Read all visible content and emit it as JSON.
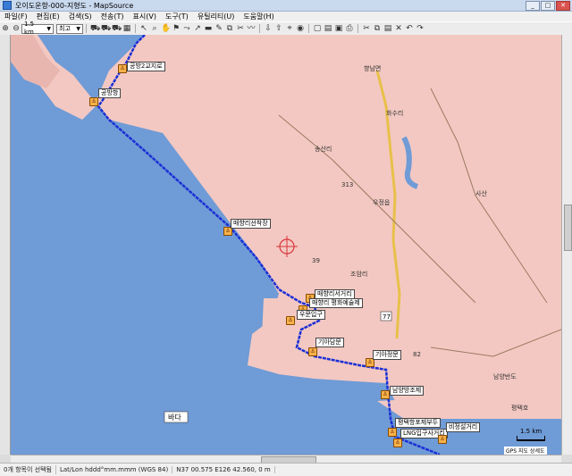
{
  "window": {
    "title": "오이도운항-000-지형도 - MapSource"
  },
  "menu": [
    "파일(F)",
    "편집(E)",
    "검색(S)",
    "전송(T)",
    "표시(V)",
    "도구(T)",
    "유틸리티(U)",
    "도움말(H)"
  ],
  "toolbar": {
    "zoom_value": "1.5 km",
    "mode_value": "최고"
  },
  "map": {
    "sea_label": "바다",
    "scale_label": "1.5 km",
    "gps_label": "GPS 지도 상세도",
    "waypoints": [
      {
        "label": "공방2교지로"
      },
      {
        "label": "공방항"
      },
      {
        "label": "매향리선착장"
      },
      {
        "label": "매향리서거리"
      },
      {
        "label": "매향리 평화예술제"
      },
      {
        "label": "우문입구"
      },
      {
        "label": "기아담문"
      },
      {
        "label": "기아정문"
      },
      {
        "label": "남양방조제"
      },
      {
        "label": "평택항포제부두"
      },
      {
        "label": "LNG입구사거리"
      },
      {
        "label": "비정설거리"
      }
    ],
    "place_labels": [
      "향남면",
      "화수리",
      "송산리",
      "우정읍",
      "조암리",
      "사산",
      "남양반도",
      "평택호"
    ],
    "road_numbers": [
      "77",
      "313",
      "82",
      "39"
    ]
  },
  "status": {
    "items": "0개 항목이 선택됨",
    "format": "Lat/Lon hddd°mm.mmm (WGS 84)",
    "coords": "N37 00.575 E126 42.560, 0 m"
  }
}
